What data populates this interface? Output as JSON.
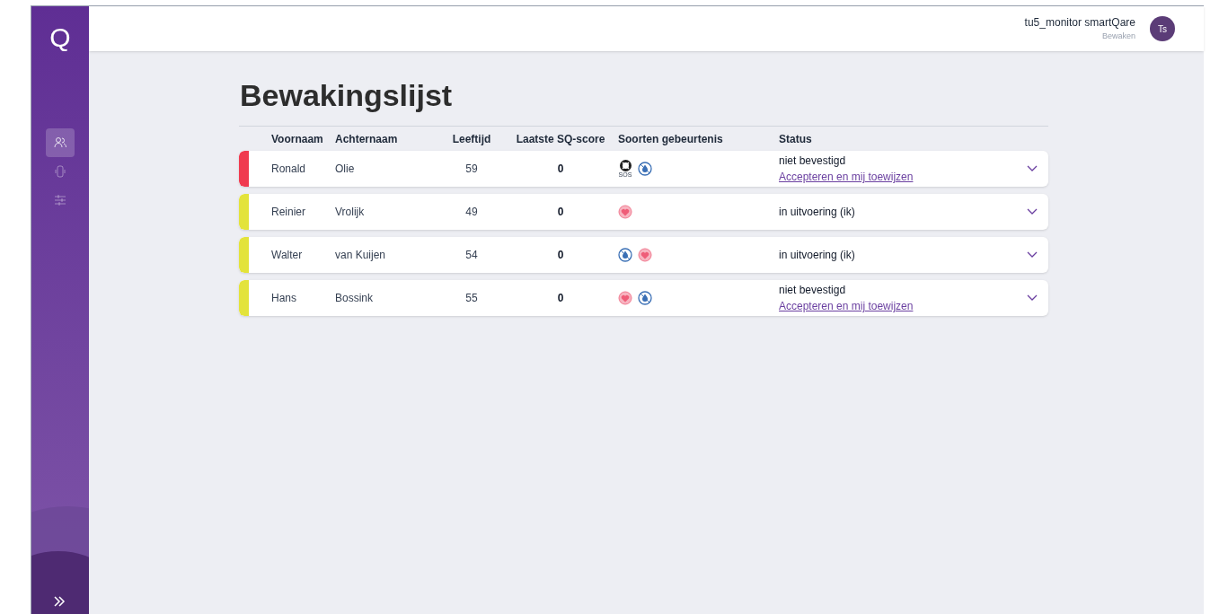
{
  "sidebar": {
    "logo": "Q",
    "items": [
      {
        "kind": "people",
        "selected": true
      },
      {
        "kind": "device",
        "selected": false
      },
      {
        "kind": "sliders",
        "selected": false
      }
    ]
  },
  "header": {
    "user": "tu5_monitor smartQare",
    "role": "Bewaken",
    "avatar": "Ts"
  },
  "title": "Bewakingslijst",
  "table": {
    "columns": [
      "Voornaam",
      "Achternaam",
      "Leeftijd",
      "Laatste SQ-score",
      "Soorten gebeurtenis",
      "Status"
    ],
    "rows": [
      {
        "color": "#f03a4f",
        "first": "Ronald",
        "last": "Olie",
        "age": "59",
        "score": "0",
        "events": [
          {
            "kind": "sos",
            "label": "SOS"
          },
          {
            "kind": "drop"
          }
        ],
        "status": "niet bevestigd",
        "action": "Accepteren en mij toewijzen"
      },
      {
        "color": "#e3e33b",
        "first": "Reinier",
        "last": "Vrolijk",
        "age": "49",
        "score": "0",
        "events": [
          {
            "kind": "heart"
          }
        ],
        "status": "in uitvoering (ik)"
      },
      {
        "color": "#e3e33b",
        "first": "Walter",
        "last": "van Kuijen",
        "age": "54",
        "score": "0",
        "events": [
          {
            "kind": "drop"
          },
          {
            "kind": "heart"
          }
        ],
        "status": "in uitvoering (ik)"
      },
      {
        "color": "#e3e33b",
        "first": "Hans",
        "last": "Bossink",
        "age": "55",
        "score": "0",
        "events": [
          {
            "kind": "heart"
          },
          {
            "kind": "drop"
          }
        ],
        "status": "niet bevestigd",
        "action": "Accepteren en mij toewijzen"
      }
    ]
  }
}
